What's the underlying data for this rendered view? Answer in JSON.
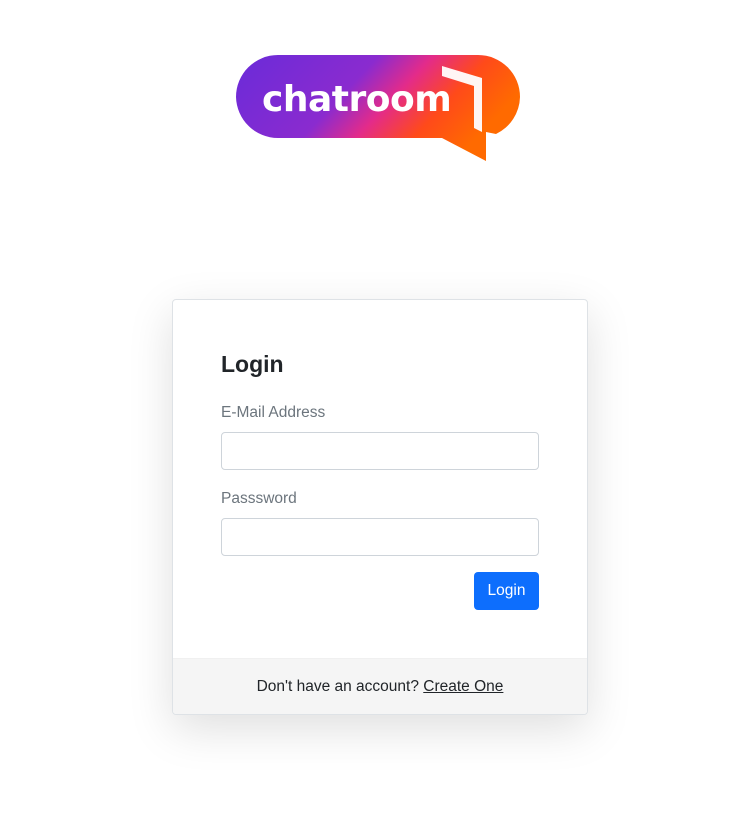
{
  "logo": {
    "text": "chatroom",
    "gradient": [
      "#6a2bd9",
      "#d62a8f",
      "#ff4a1a",
      "#ff6a00"
    ]
  },
  "login_card": {
    "title": "Login",
    "email": {
      "label": "E-Mail Address",
      "value": ""
    },
    "password": {
      "label": "Passsword",
      "value": ""
    },
    "submit_label": "Login",
    "footer": {
      "prompt": "Don't have an account?",
      "link_label": "Create One"
    }
  },
  "colors": {
    "primary_button": "#0d6efd",
    "label": "#6c757d",
    "footer_bg": "#f5f5f5"
  }
}
